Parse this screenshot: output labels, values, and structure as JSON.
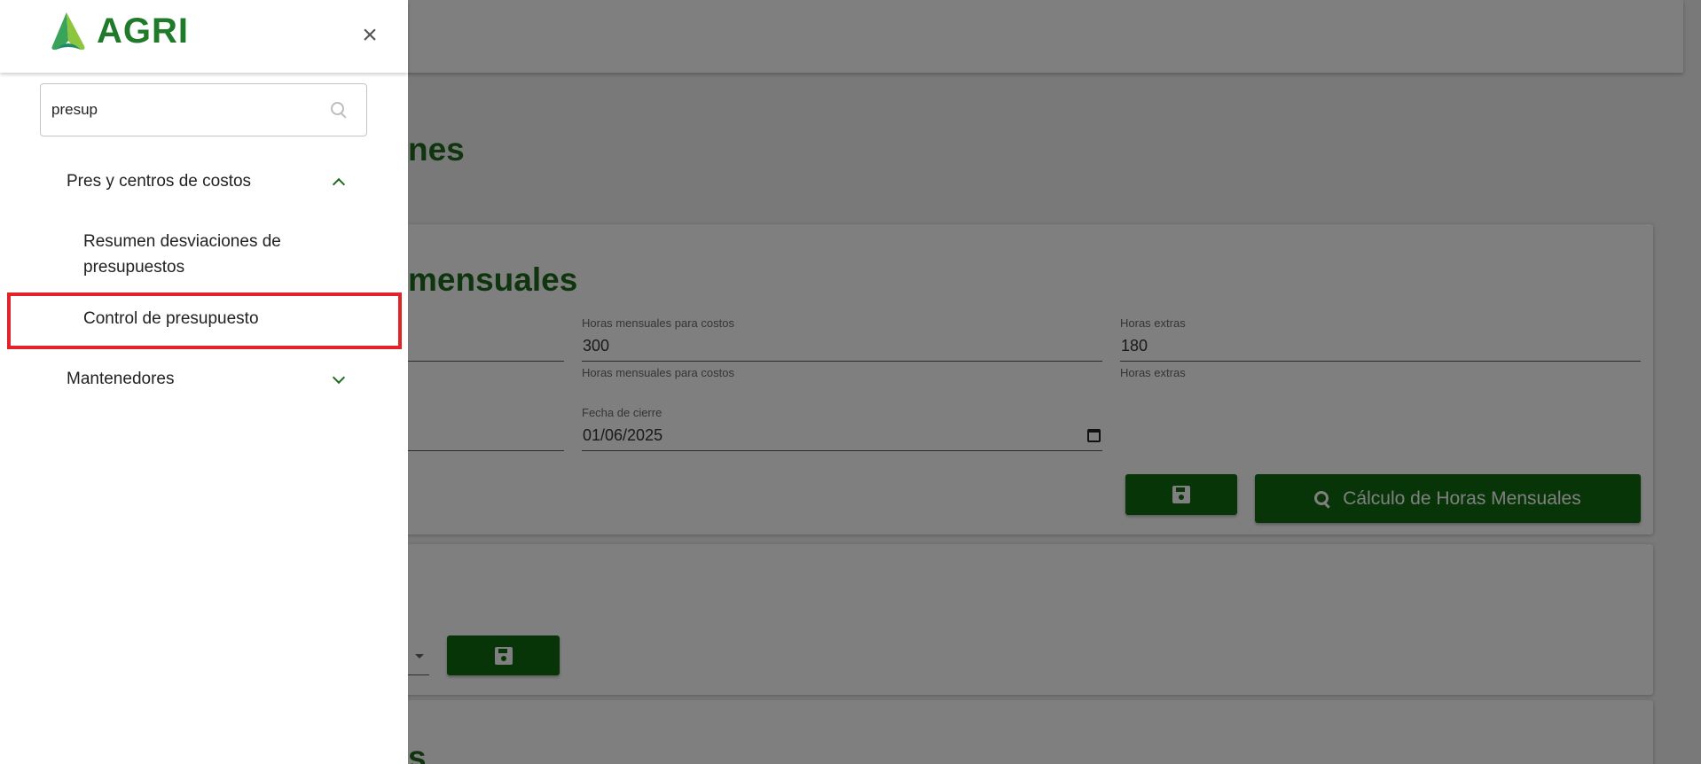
{
  "app": {
    "logo_text": "AGRI"
  },
  "drawer": {
    "search": {
      "value": "presup",
      "placeholder": ""
    },
    "groups": [
      {
        "label": "Pres y centros de costos",
        "expanded": true,
        "items": [
          {
            "label": "Resumen desviaciones de presupuestos"
          },
          {
            "label": "Control de presupuesto",
            "highlighted": true
          }
        ]
      },
      {
        "label": "Mantenedores",
        "expanded": false,
        "items": []
      }
    ]
  },
  "background": {
    "page_title": "nes",
    "card1": {
      "title": "mensuales",
      "fields": {
        "horas_mensuales": {
          "label": "Horas mensuales para costos",
          "value": "300",
          "helper": "Horas mensuales para costos"
        },
        "horas_extras": {
          "label": "Horas extras",
          "value": "180",
          "helper": "Horas extras"
        },
        "fecha_cierre": {
          "label": "Fecha de cierre",
          "value": "01/06/2025"
        }
      },
      "calc_button_label": "Cálculo de Horas Mensuales"
    },
    "card3": {
      "title": "s"
    }
  },
  "colors": {
    "brand_green": "#0f6a0f",
    "title_green": "#1f6b1f",
    "highlight_red": "#e0242a"
  }
}
